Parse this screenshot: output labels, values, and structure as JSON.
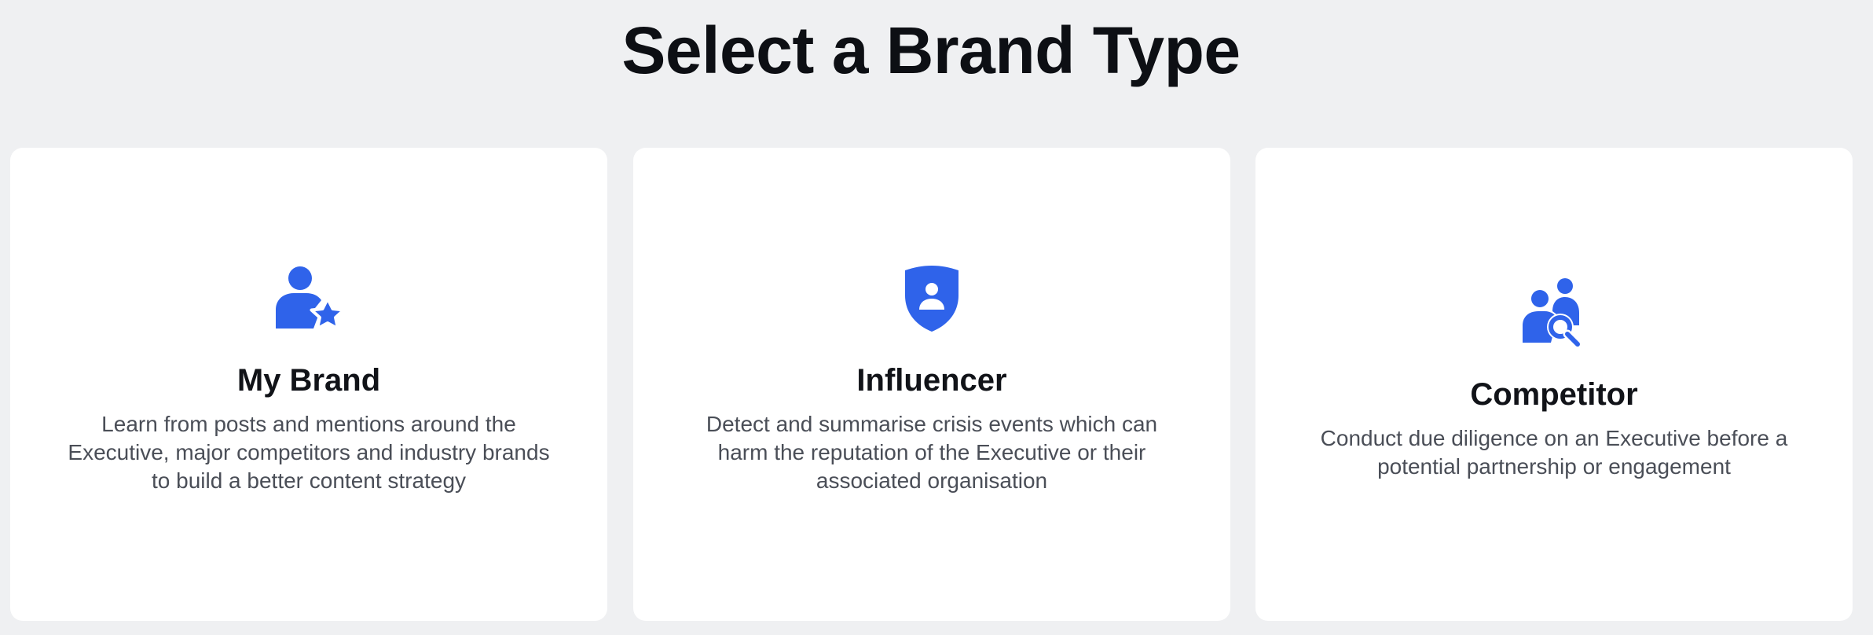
{
  "page": {
    "title": "Select a Brand Type"
  },
  "colors": {
    "accent": "#2f63ea",
    "background": "#eff0f2",
    "card": "#ffffff",
    "title_text": "#0d0f14",
    "body_text": "#4a4e57"
  },
  "cards": [
    {
      "icon": "person-star-icon",
      "title": "My Brand",
      "description": "Learn from posts and mentions around the Executive, major competitors and industry brands to build a better content strategy"
    },
    {
      "icon": "shield-person-icon",
      "title": "Influencer",
      "description": "Detect and summarise crisis events which can harm the reputation of the Executive or their associated organisation"
    },
    {
      "icon": "people-search-icon",
      "title": "Competitor",
      "description": "Conduct due diligence on an Executive before a potential partnership or engagement"
    }
  ]
}
